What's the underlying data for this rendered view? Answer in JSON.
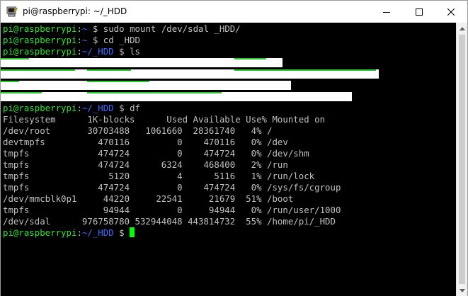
{
  "window": {
    "title": "pi@raspberrypi: ~/_HDD"
  },
  "prompt": {
    "user_host": "pi@raspberrypi",
    "sep": ":",
    "home_path": "~",
    "hdd_path": "~/_HDD",
    "symbol": " $ "
  },
  "session": {
    "cmd1": "sudo mount /dev/sdal _HDD/",
    "cmd2": "cd _HDD",
    "cmd3": "ls",
    "cmd4": "df"
  },
  "df_table": {
    "header": "Filesystem      1K-blocks      Used Available Use% Mounted on",
    "rows": [
      "/dev/root       30703488   1061660  28361740   4% /",
      "devtmpfs          470116         0    470116   0% /dev",
      "tmpfs             474724         0    474724   0% /dev/shm",
      "tmpfs             474724      6324    468400   2% /run",
      "tmpfs               5120         4      5116   1% /run/lock",
      "tmpfs             474724         0    474724   0% /sys/fs/cgroup",
      "/dev/mmcblk0p1     44220     22541     21679  51% /boot",
      "tmpfs              94944         0     94944   0% /run/user/1000",
      "/dev/sdal      976758780 532944048 443814732  55% /home/pi/_HDD"
    ]
  },
  "colors": {
    "prompt_green": "#2ee52e",
    "path_blue": "#3b6bff",
    "terminal_bg": "#000000",
    "terminal_text": "#c0c0c0",
    "cursor": "#00ff00"
  },
  "icons": {
    "app": "putty-terminal-icon",
    "minimize": "minimize-icon",
    "maximize": "maximize-icon",
    "close": "close-icon"
  }
}
